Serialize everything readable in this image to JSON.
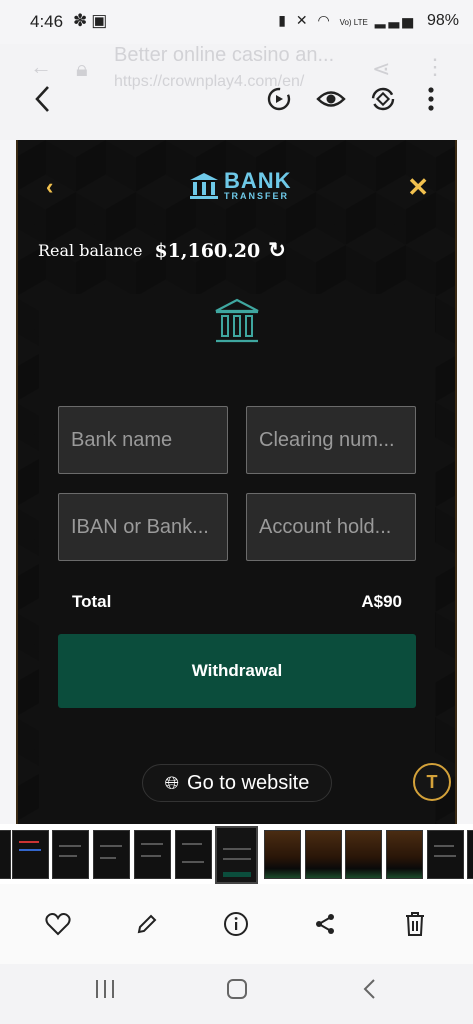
{
  "status_bar": {
    "time": "4:46",
    "left_icons": [
      "flower-icon",
      "image-icon"
    ],
    "right_icons": [
      "battery-saver-icon",
      "mute-icon",
      "wifi-icon",
      "volte-icon",
      "signal-icon"
    ],
    "volte_text": "Vo) LTE",
    "battery": "98%"
  },
  "viewer": {
    "ghost_title": "Better online casino an...",
    "ghost_url": "https://crownplay4.com/en/",
    "top_icons": [
      "back-icon",
      "remaster-icon",
      "eye-icon",
      "rotate-icon",
      "more-icon"
    ]
  },
  "screenshot": {
    "header": {
      "logo_big": "BANK",
      "logo_small": "TRANSFER"
    },
    "balance_label": "Real balance",
    "balance_amount": "$1,160.20",
    "fields": {
      "bank_name_placeholder": "Bank name",
      "clearing_placeholder": "Clearing num...",
      "iban_placeholder": "IBAN or Bank...",
      "holder_placeholder": "Account hold..."
    },
    "total_label": "Total",
    "total_value": "A$90",
    "withdraw_label": "Withdrawal",
    "goto_label": "Go to website",
    "colors": {
      "accent_gold": "#f2c14e",
      "bank_blue": "#6ec9e8",
      "withdraw_green": "#0b4d3c"
    }
  },
  "actions": {
    "items": [
      "heart-icon",
      "edit-icon",
      "info-icon",
      "share-icon",
      "delete-icon"
    ]
  },
  "nav": {
    "items": [
      "recents-icon",
      "home-icon",
      "back-icon"
    ]
  }
}
